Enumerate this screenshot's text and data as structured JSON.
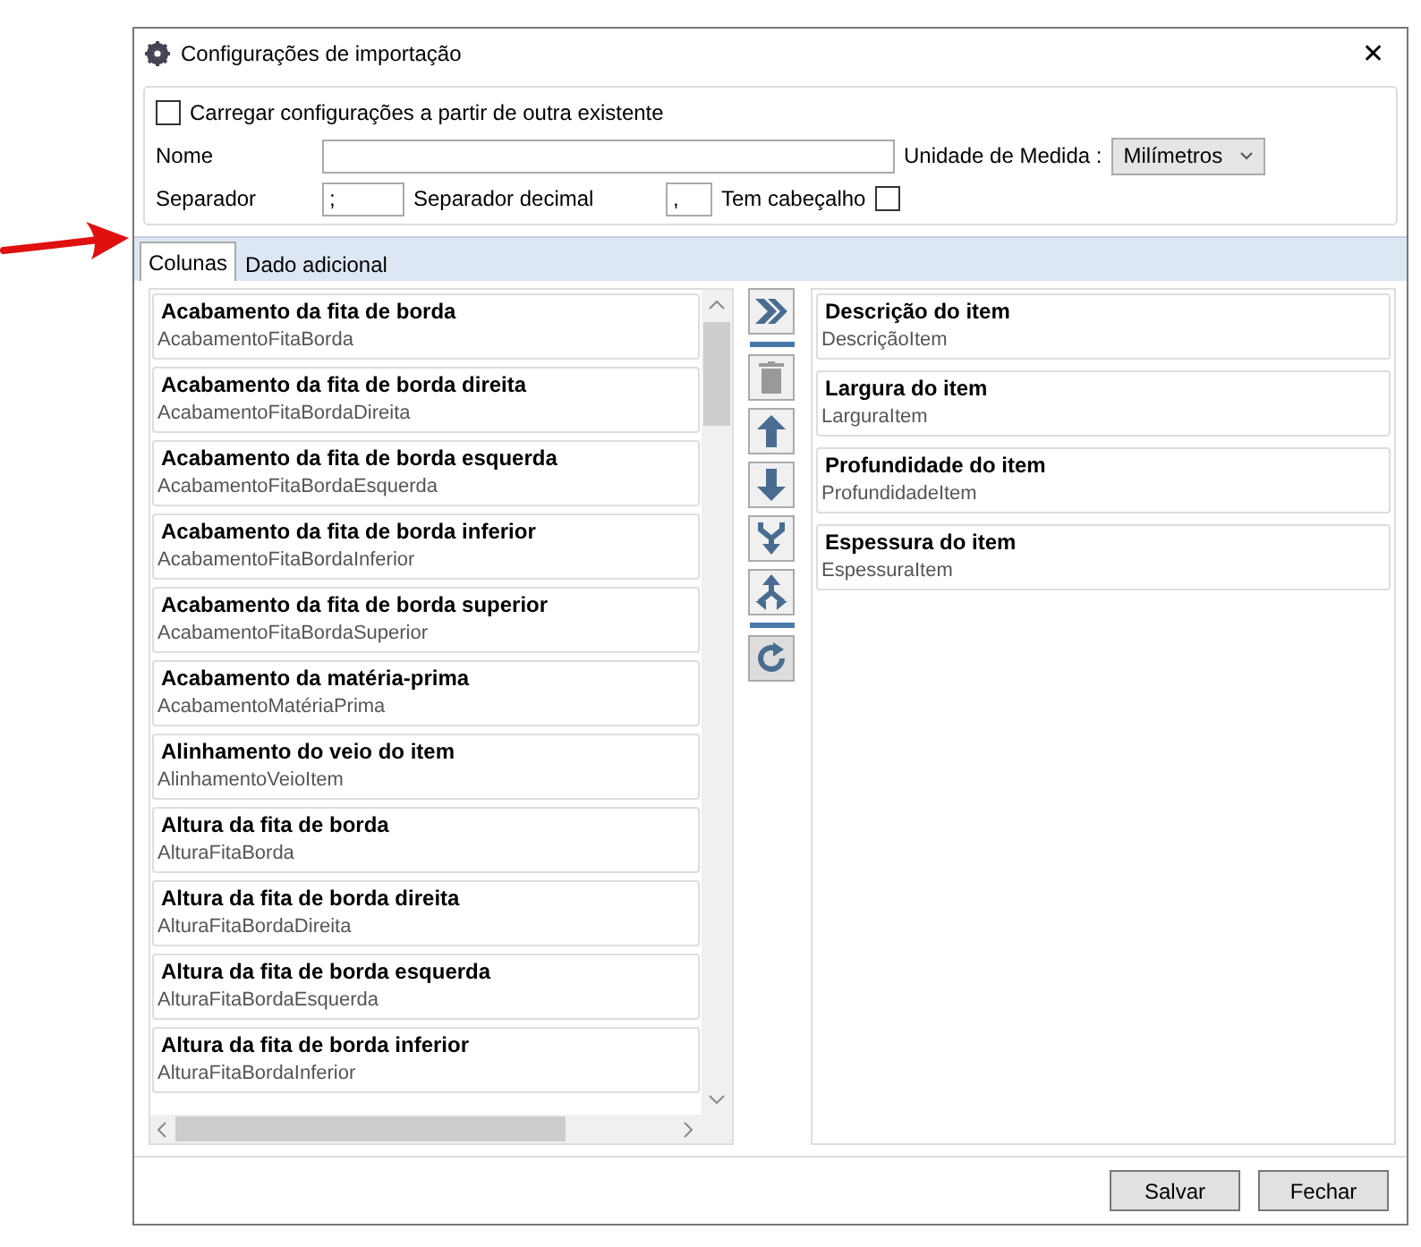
{
  "window": {
    "title": "Configurações de importação",
    "close": "✕"
  },
  "settings": {
    "load_existing": {
      "label": "Carregar configurações a partir de outra existente",
      "checked": false
    },
    "name": {
      "label": "Nome"
    },
    "unit": {
      "label": "Unidade de Medida :",
      "value": "Milímetros"
    },
    "separator": {
      "label": "Separador",
      "value": ";"
    },
    "decimal_separator": {
      "label": "Separador decimal",
      "value": ","
    },
    "has_header": {
      "label": "Tem cabeçalho",
      "checked": false
    }
  },
  "tabs": [
    {
      "label": "Colunas",
      "selected": true
    },
    {
      "label": "Dado adicional",
      "selected": false
    }
  ],
  "available_columns": [
    {
      "title": "Acabamento da fita de borda",
      "field": "AcabamentoFitaBorda"
    },
    {
      "title": "Acabamento da fita de borda direita",
      "field": "AcabamentoFitaBordaDireita"
    },
    {
      "title": "Acabamento da fita de borda esquerda",
      "field": "AcabamentoFitaBordaEsquerda"
    },
    {
      "title": "Acabamento da fita de borda inferior",
      "field": "AcabamentoFitaBordaInferior"
    },
    {
      "title": "Acabamento da fita de borda superior",
      "field": "AcabamentoFitaBordaSuperior"
    },
    {
      "title": "Acabamento da matéria-prima",
      "field": "AcabamentoMatériaPrima"
    },
    {
      "title": "Alinhamento do veio do item",
      "field": "AlinhamentoVeioItem"
    },
    {
      "title": "Altura da fita de borda",
      "field": "AlturaFitaBorda"
    },
    {
      "title": "Altura da fita de borda direita",
      "field": "AlturaFitaBordaDireita"
    },
    {
      "title": "Altura da fita de borda esquerda",
      "field": "AlturaFitaBordaEsquerda"
    },
    {
      "title": "Altura da fita de borda inferior",
      "field": "AlturaFitaBordaInferior"
    }
  ],
  "tools": [
    {
      "kind": "add",
      "disabled": false
    },
    {
      "kind": "separator"
    },
    {
      "kind": "delete",
      "disabled": true
    },
    {
      "kind": "up",
      "disabled": false
    },
    {
      "kind": "down",
      "disabled": false
    },
    {
      "kind": "merge",
      "disabled": false
    },
    {
      "kind": "split",
      "disabled": false
    },
    {
      "kind": "separator"
    },
    {
      "kind": "refresh",
      "disabled": false
    }
  ],
  "selected_columns": [
    {
      "title": "Descrição do item",
      "field": "DescriçãoItem"
    },
    {
      "title": "Largura do item",
      "field": "LarguraItem"
    },
    {
      "title": "Profundidade do item",
      "field": "ProfundidadeItem"
    },
    {
      "title": "Espessura do item",
      "field": "EspessuraItem"
    }
  ],
  "buttons": [
    "Salvar",
    "Fechar"
  ]
}
